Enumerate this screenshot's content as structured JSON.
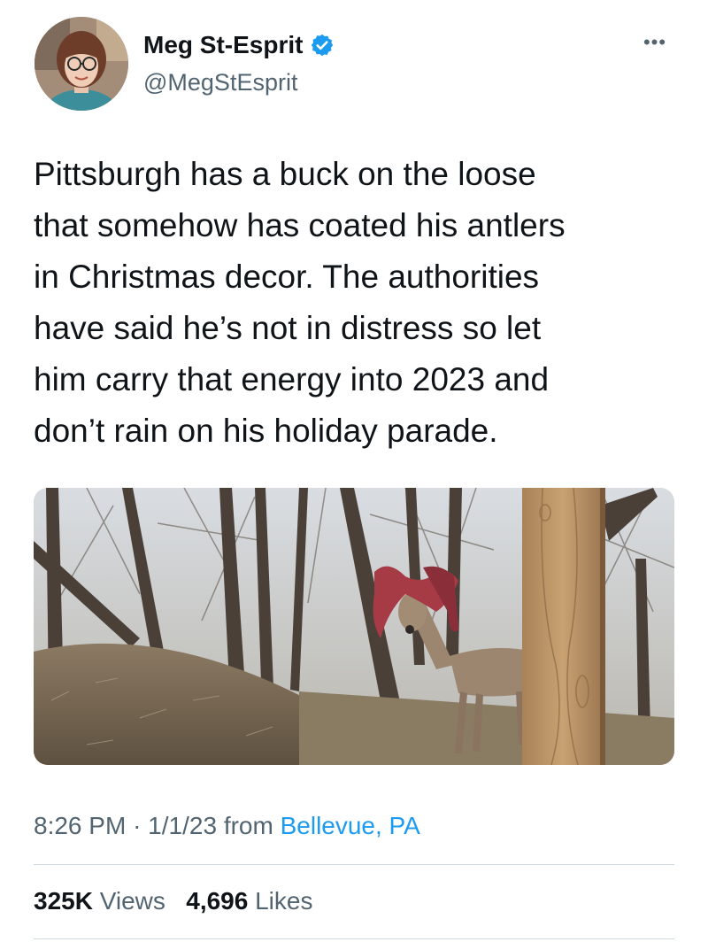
{
  "author": {
    "display_name": "Meg St-Esprit",
    "handle": "@MegStEsprit",
    "verified": true,
    "verified_color": "#1d9bf0"
  },
  "more_icon": "more-horizontal-icon",
  "tweet": {
    "text": "Pittsburgh has a buck on the loose\nthat somehow has coated his antlers\nin Christmas decor. The authorities\nhave said he’s not in distress so let\nhim carry that energy into 2023 and\ndon’t rain on his holiday parade."
  },
  "meta": {
    "time": "8:26 PM",
    "separator": "·",
    "date": "1/1/23",
    "from_label": "from",
    "location": "Bellevue, PA"
  },
  "stats": {
    "views_count": "325K",
    "views_label": "Views",
    "likes_count": "4,696",
    "likes_label": "Likes"
  },
  "colors": {
    "text": "#0f1419",
    "secondary": "#536471",
    "link": "#1d9bf0",
    "divider": "#cfd9de"
  }
}
